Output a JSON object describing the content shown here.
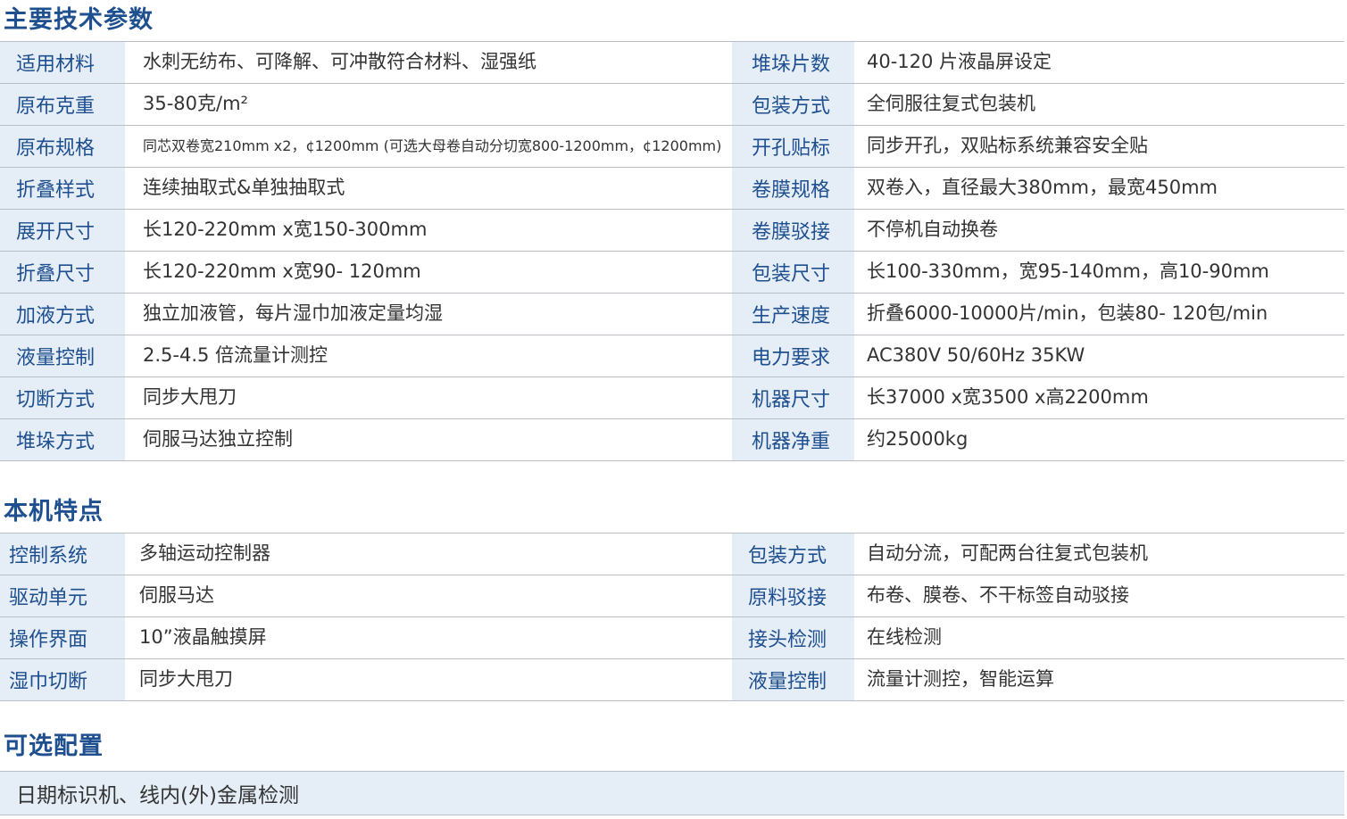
{
  "sections": {
    "tech_title": "主要技术参数",
    "features_title": "本机特点",
    "options_title": "可选配置"
  },
  "tech_rows": [
    {
      "l1": "适用材料",
      "v1": "水刺无纺布、可降解、可冲散符合材料、湿强纸",
      "l2": "堆垛片数",
      "v2": "40-120 片液晶屏设定"
    },
    {
      "l1": "原布克重",
      "v1": "35-80克/m²",
      "l2": "包装方式",
      "v2": "全伺服往复式包装机"
    },
    {
      "l1": "原布规格",
      "v1": "同芯双卷宽210mm x2，¢1200mm (可选大母卷自动分切宽800-1200mm，¢1200mm)",
      "l2": "开孔贴标",
      "v2": "同步开孔，双贴标系统兼容安全贴"
    },
    {
      "l1": "折叠样式",
      "v1": "连续抽取式&单独抽取式",
      "l2": "卷膜规格",
      "v2": "双卷入，直径最大380mm，最宽450mm"
    },
    {
      "l1": "展开尺寸",
      "v1": "长120-220mm x宽150-300mm",
      "l2": "卷膜驳接",
      "v2": "不停机自动换卷"
    },
    {
      "l1": "折叠尺寸",
      "v1": "长120-220mm x宽90- 120mm",
      "l2": "包装尺寸",
      "v2": "长100-330mm，宽95-140mm，高10-90mm"
    },
    {
      "l1": "加液方式",
      "v1": "独立加液管，每片湿巾加液定量均湿",
      "l2": "生产速度",
      "v2": "折叠6000-10000片/min，包装80- 120包/min"
    },
    {
      "l1": "液量控制",
      "v1": "2.5-4.5 倍流量计测控",
      "l2": "电力要求",
      "v2": "AC380V 50/60Hz 35KW"
    },
    {
      "l1": "切断方式",
      "v1": "同步大甩刀",
      "l2": "机器尺寸",
      "v2": "长37000 x宽3500 x高2200mm"
    },
    {
      "l1": "堆垛方式",
      "v1": "伺服马达独立控制",
      "l2": "机器净重",
      "v2": "约25000kg"
    }
  ],
  "feature_rows": [
    {
      "l1": "控制系统",
      "v1": "多轴运动控制器",
      "l2": "包装方式",
      "v2": "自动分流，可配两台往复式包装机"
    },
    {
      "l1": "驱动单元",
      "v1": "伺服马达",
      "l2": "原料驳接",
      "v2": "布卷、膜卷、不干标签自动驳接"
    },
    {
      "l1": "操作界面",
      "v1": "10”液晶触摸屏",
      "l2": "接头检测",
      "v2": "在线检测"
    },
    {
      "l1": "湿巾切断",
      "v1": "同步大甩刀",
      "l2": "液量控制",
      "v2": "流量计测控，智能运算"
    }
  ],
  "options_text": "日期标识机、线内(外)金属检测",
  "colors": {
    "title": "#1e4f8f",
    "label_bg": "#e5edf7",
    "border": "#b9bec4"
  }
}
